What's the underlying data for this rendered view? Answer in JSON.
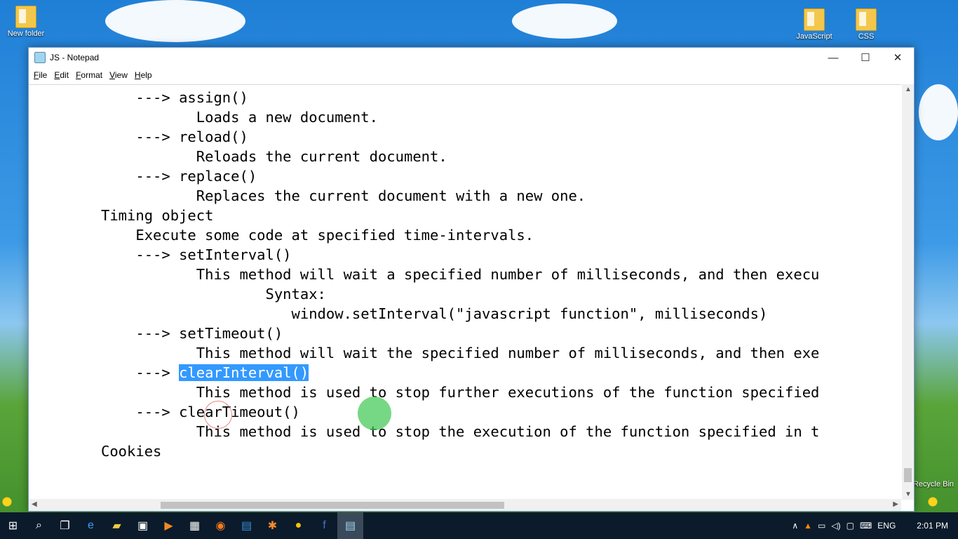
{
  "desktop": {
    "icons": [
      {
        "label": "New folder"
      },
      {
        "label": "JavaScript"
      },
      {
        "label": "CSS"
      },
      {
        "label": "Recycle Bin"
      }
    ]
  },
  "window": {
    "title": "JS - Notepad",
    "menu": [
      "File",
      "Edit",
      "Format",
      "View",
      "Help"
    ],
    "controls": {
      "minimize": "—",
      "maximize": "☐",
      "close": "✕"
    }
  },
  "editor": {
    "lines": [
      "    ---> assign()",
      "           Loads a new document.",
      "    ---> reload()",
      "           Reloads the current document.",
      "    ---> replace()",
      "           Replaces the current document with a new one.",
      "Timing object",
      "    Execute some code at specified time-intervals.",
      "    ---> setInterval()",
      "           This method will wait a specified number of milliseconds, and then execu",
      "                   Syntax:",
      "                      window.setInterval(\"javascript function\", milliseconds)",
      "    ---> setTimeout()",
      "           This method will wait the specified number of milliseconds, and then exe"
    ],
    "selected_line_prefix": "    ---> ",
    "selected_text": "clearInterval()",
    "lines_after": [
      "           This method is used to stop further executions of the function specified",
      "    ---> clearTimeout()",
      "           This method is used to stop the execution of the function specified in t",
      "Cookies"
    ]
  },
  "taskbar": {
    "language": "ENG",
    "time": "2:01 PM"
  }
}
